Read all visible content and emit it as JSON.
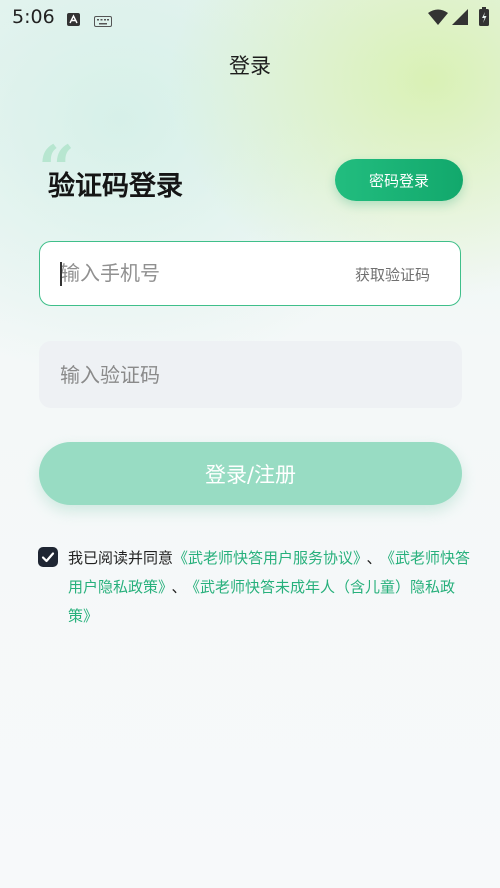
{
  "status_bar": {
    "time": "5:06"
  },
  "nav": {
    "title": "登录"
  },
  "login": {
    "heading": "验证码登录",
    "switch_button": "密码登录",
    "phone_placeholder": "输入手机号",
    "get_code_label": "获取验证码",
    "code_placeholder": "输入验证码",
    "submit_label": "登录/注册"
  },
  "agreement": {
    "checked": true,
    "prefix": "我已阅读并同意",
    "link_service": "《武老师快答用户服务协议》",
    "sep1": "、",
    "link_privacy": "《武老师快答用户隐私政策》",
    "sep2": "、",
    "link_minor": "《武老师快答未成年人（含儿童）隐私政策》"
  },
  "colors": {
    "accent": "#1aaf74",
    "link": "#27b07c",
    "submit_disabled": "#98dcc3"
  }
}
